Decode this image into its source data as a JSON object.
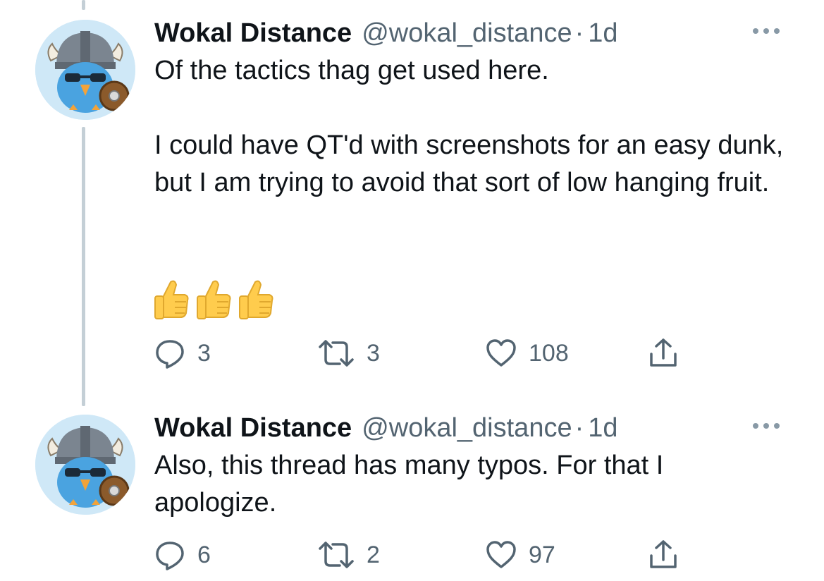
{
  "tweets": [
    {
      "author_name": "Wokal Distance",
      "author_handle": "@wokal_distance",
      "separator": "·",
      "timestamp": "1d",
      "avatar_icon": "viking-bird-avatar-icon",
      "paragraphs": [
        "Of the tactics thag get used here.",
        "I could have QT'd with screenshots for an easy dunk, but I am trying to avoid that sort of low hanging fruit."
      ],
      "emoji": [
        "👍",
        "👍",
        "👍"
      ],
      "reply_count": "3",
      "retweet_count": "3",
      "like_count": "108"
    },
    {
      "author_name": "Wokal Distance",
      "author_handle": "@wokal_distance",
      "separator": "·",
      "timestamp": "1d",
      "avatar_icon": "viking-bird-avatar-icon",
      "paragraphs": [
        "Also, this thread has many typos. For that I apologize."
      ],
      "reply_count": "6",
      "retweet_count": "2",
      "like_count": "97"
    }
  ],
  "colors": {
    "text": "#0f1419",
    "secondary": "#536471",
    "thread_line": "#c4cfd6"
  }
}
